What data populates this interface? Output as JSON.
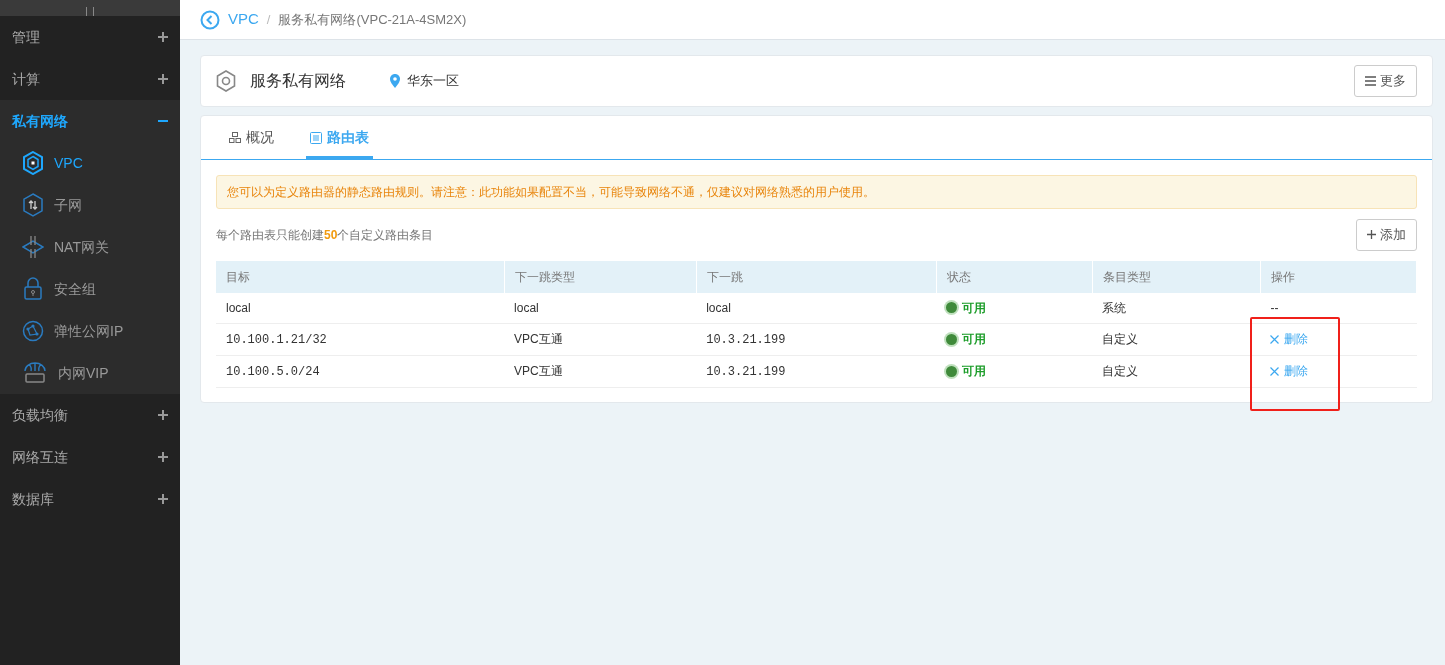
{
  "sidebar": {
    "groups": [
      {
        "label": "管理",
        "expanded": false
      },
      {
        "label": "计算",
        "expanded": false
      },
      {
        "label": "私有网络",
        "expanded": true,
        "items": [
          {
            "label": "VPC",
            "selected": true
          },
          {
            "label": "子网",
            "selected": false
          },
          {
            "label": "NAT网关",
            "selected": false
          },
          {
            "label": "安全组",
            "selected": false
          },
          {
            "label": "弹性公网IP",
            "selected": false
          },
          {
            "label": "内网VIP",
            "selected": false
          }
        ]
      },
      {
        "label": "负载均衡",
        "expanded": false
      },
      {
        "label": "网络互连",
        "expanded": false
      },
      {
        "label": "数据库",
        "expanded": false
      }
    ]
  },
  "breadcrumb": {
    "parent": "VPC",
    "separator": "/",
    "current": "服务私有网络(VPC-21A-4SM2X)"
  },
  "header_card": {
    "title": "服务私有网络",
    "region": "华东一区",
    "more_button": "更多"
  },
  "tabs": [
    {
      "label": "概况",
      "selected": false
    },
    {
      "label": "路由表",
      "selected": true
    }
  ],
  "alert": "您可以为定义路由器的静态路由规则。请注意：此功能如果配置不当，可能导致网络不通，仅建议对网络熟悉的用户使用。",
  "limit_note": "每个路由表只能创建**50**个自定义路由条目",
  "add_button": "添加",
  "table": {
    "columns": [
      "目标",
      "下一跳类型",
      "下一跳",
      "状态",
      "条目类型",
      "操作"
    ],
    "rows": [
      {
        "target": "local",
        "next_hop_type": "local",
        "next_hop": "local",
        "status": "可用",
        "entry_type": "系统",
        "action": "--",
        "deletable": false,
        "highlighted": false
      },
      {
        "target": "10.100.1.21/32",
        "next_hop_type": "VPC互通",
        "next_hop": "10.3.21.199",
        "status": "可用",
        "entry_type": "自定义",
        "action": "删除",
        "deletable": true,
        "highlighted": true
      },
      {
        "target": "10.100.5.0/24",
        "next_hop_type": "VPC互通",
        "next_hop": "10.3.21.199",
        "status": "可用",
        "entry_type": "自定义",
        "action": "删除",
        "deletable": true,
        "highlighted": true
      }
    ]
  }
}
